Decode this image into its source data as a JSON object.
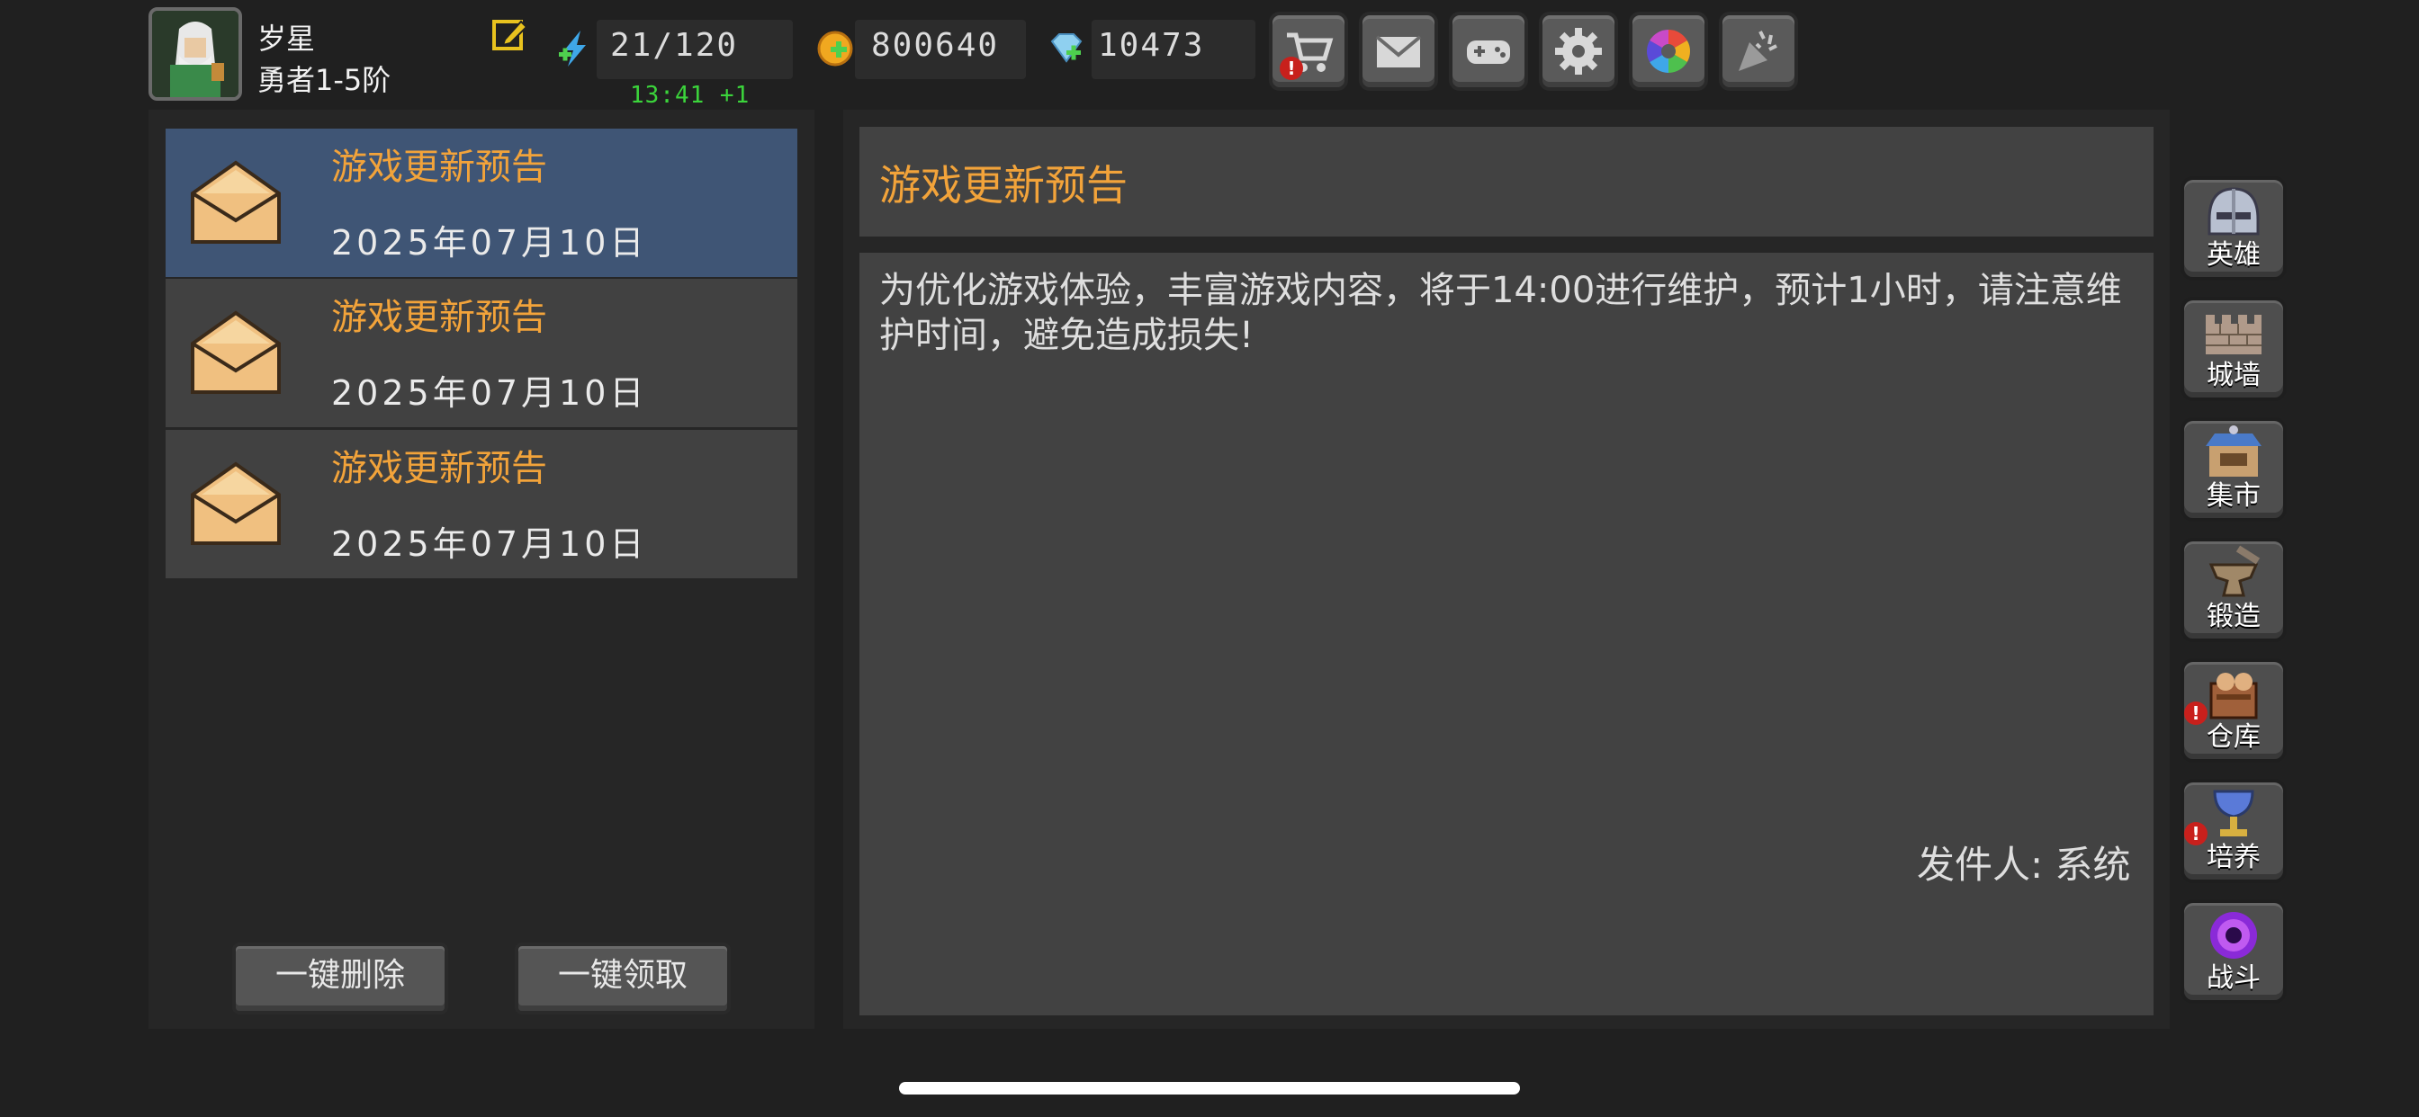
{
  "player": {
    "name": "岁星",
    "rank": "勇者1-5阶"
  },
  "resources": {
    "stamina": "21/120",
    "stamina_regen": "13:41 +1",
    "gold": "800640",
    "diamond": "10473"
  },
  "top_buttons": [
    {
      "icon": "cart-icon",
      "alert": "!"
    },
    {
      "icon": "mail-icon"
    },
    {
      "icon": "gamepad-icon"
    },
    {
      "icon": "gear-icon"
    },
    {
      "icon": "color-wheel-icon"
    },
    {
      "icon": "party-popper-icon"
    }
  ],
  "mail_list": [
    {
      "title": "游戏更新预告",
      "date": "2025年07月10日"
    },
    {
      "title": "游戏更新预告",
      "date": "2025年07月10日"
    },
    {
      "title": "游戏更新预告",
      "date": "2025年07月10日"
    }
  ],
  "actions": {
    "delete_all": "一键删除",
    "claim_all": "一键领取"
  },
  "detail": {
    "title": "游戏更新预告",
    "body": "为优化游戏体验，丰富游戏内容，将于14:00进行维护，预计1小时，请注意维护时间，避免造成损失!",
    "sender": "发件人: 系统"
  },
  "side_nav": [
    {
      "label": "英雄",
      "icon": "helmet-icon"
    },
    {
      "label": "城墙",
      "icon": "wall-icon"
    },
    {
      "label": "集市",
      "icon": "market-icon"
    },
    {
      "label": "锻造",
      "icon": "anvil-icon"
    },
    {
      "label": "仓库",
      "icon": "warehouse-icon",
      "alert": "!"
    },
    {
      "label": "培养",
      "icon": "chalice-icon",
      "alert": "!"
    },
    {
      "label": "战斗",
      "icon": "portal-icon"
    }
  ],
  "colors": {
    "accent_orange": "#f2a33a",
    "selected_row": "#3f5575",
    "regen_green": "#3bd43b",
    "alert_red": "#c8201c"
  }
}
